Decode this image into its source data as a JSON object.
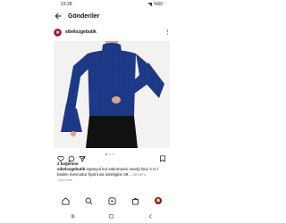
{
  "status_bar": {
    "time": "23:28",
    "battery": "%60"
  },
  "header": {
    "title": "Gönderiler"
  },
  "post": {
    "username": "sibelozgebutik",
    "likes": "2 beğenme",
    "caption_user": "sibelozgebutik",
    "caption_text": " ispanyol kol sakomavisi sandy bluz s m l beden mevcuttur fiyat kısa süreligine 29...",
    "more_label": " devamı",
    "time": "1 gün önce"
  },
  "carousel": {
    "count": 3,
    "active": 0
  },
  "colors": {
    "accent": "#3897f0",
    "top": "#1e3a8a",
    "trousers": "#111111"
  }
}
